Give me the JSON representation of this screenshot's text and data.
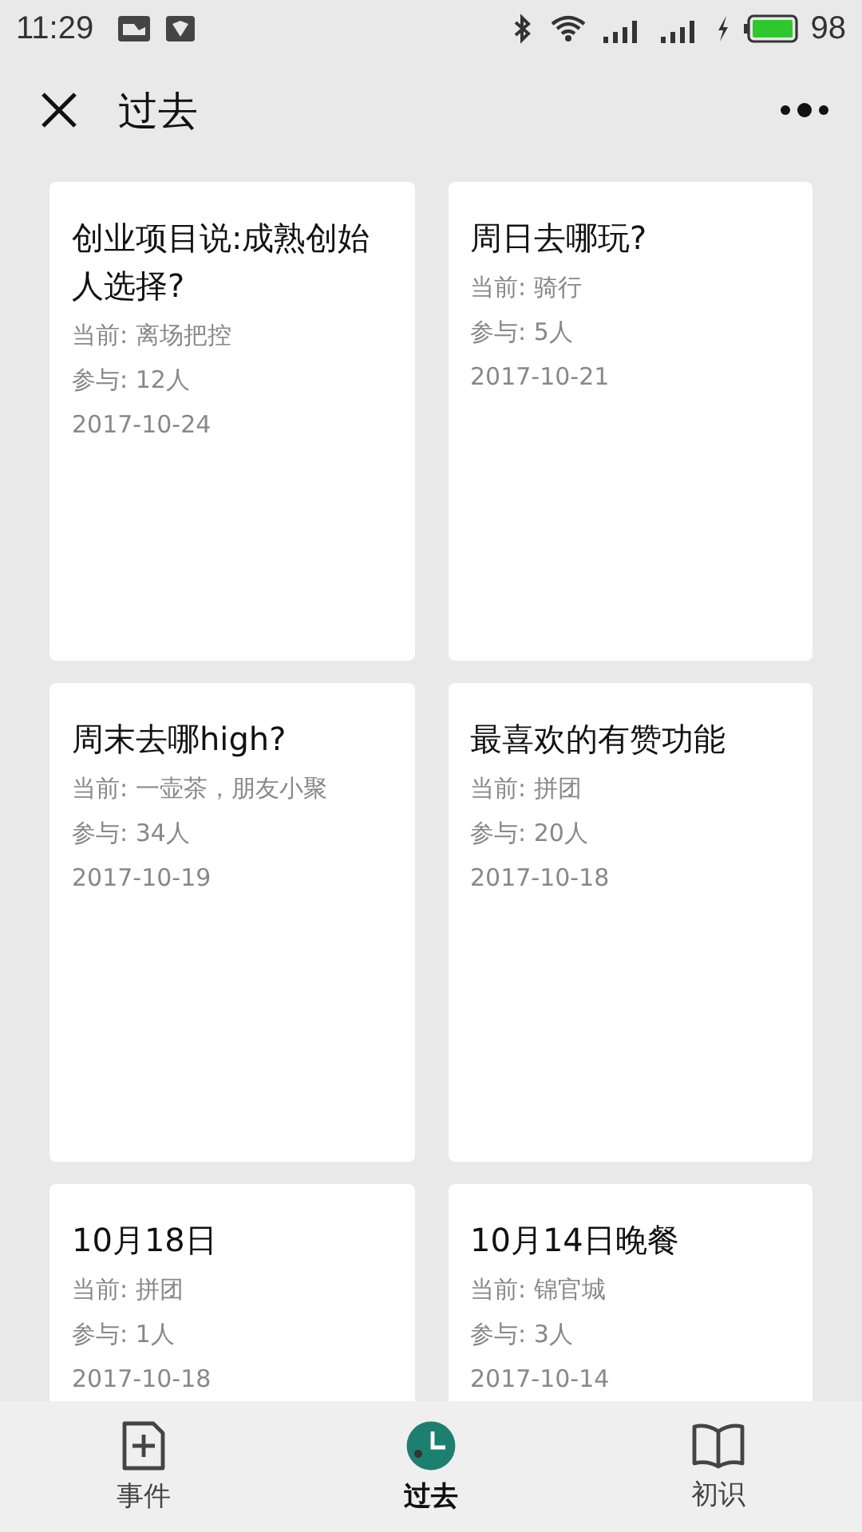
{
  "status_bar": {
    "time": "11:29",
    "battery": "98"
  },
  "header": {
    "title": "过去"
  },
  "cards": [
    {
      "title": "创业项目说:成熟创始人选择?",
      "current_label": "当前:",
      "current": "离场把控",
      "participants_label": "参与:",
      "participants": "12人",
      "date": "2017-10-24"
    },
    {
      "title": "周日去哪玩?",
      "current_label": "当前:",
      "current": "骑行",
      "participants_label": "参与:",
      "participants": "5人",
      "date": "2017-10-21"
    },
    {
      "title": "周末去哪high?",
      "current_label": "当前:",
      "current": "一壶茶，朋友小聚",
      "participants_label": "参与:",
      "participants": "34人",
      "date": "2017-10-19"
    },
    {
      "title": "最喜欢的有赞功能",
      "current_label": "当前:",
      "current": "拼团",
      "participants_label": "参与:",
      "participants": "20人",
      "date": "2017-10-18"
    },
    {
      "title": "10月18日",
      "current_label": "当前:",
      "current": "拼团",
      "participants_label": "参与:",
      "participants": "1人",
      "date": "2017-10-18"
    },
    {
      "title": "10月14日晚餐",
      "current_label": "当前:",
      "current": "锦官城",
      "participants_label": "参与:",
      "participants": "3人",
      "date": "2017-10-14"
    }
  ],
  "tab_bar": [
    {
      "kind": "add",
      "label": "事件",
      "selected": false
    },
    {
      "kind": "clock",
      "label": "过去",
      "selected": true
    },
    {
      "kind": "book",
      "label": "初识",
      "selected": false
    }
  ]
}
